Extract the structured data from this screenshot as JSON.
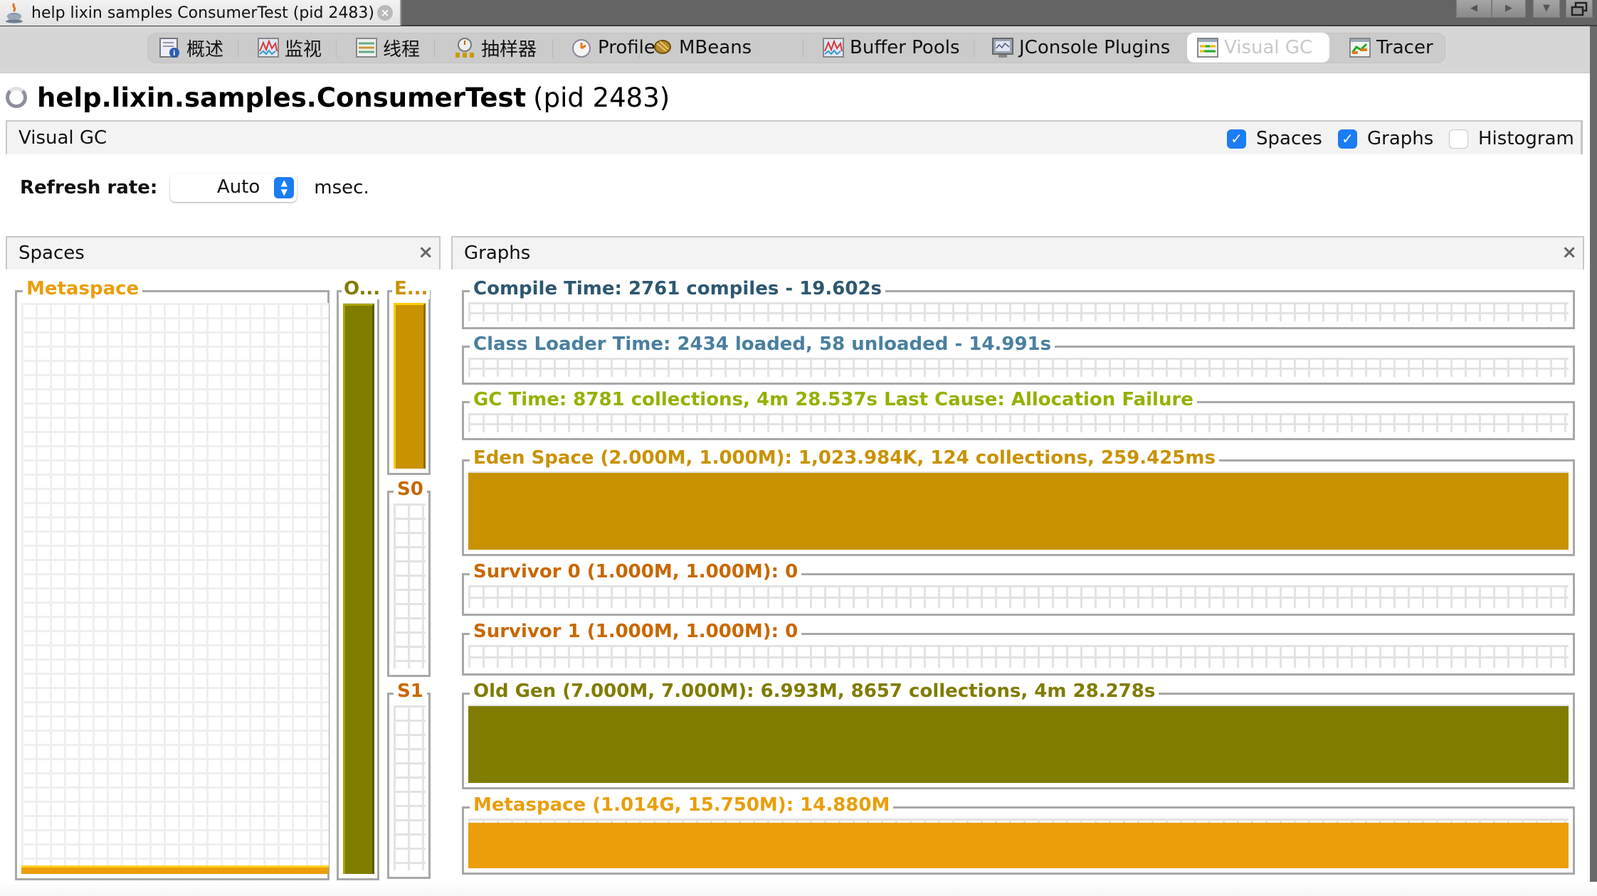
{
  "window": {
    "tab_label": "help lixin samples ConsumerTest (pid 2483)",
    "tab_icon": "java-cup-icon",
    "controls": [
      "scroll-left",
      "scroll-right",
      "tab-list",
      "restore-window"
    ]
  },
  "toolbar": {
    "items": [
      {
        "label": "概述",
        "icon": "overview-icon",
        "active": false
      },
      {
        "label": "监视",
        "icon": "monitor-icon",
        "active": false
      },
      {
        "label": "线程",
        "icon": "threads-icon",
        "active": false
      },
      {
        "label": "抽样器",
        "icon": "sampler-icon",
        "active": false
      },
      {
        "label": "Profiler",
        "icon": "profiler-icon",
        "active": false
      },
      {
        "label": "MBeans",
        "icon": "mbeans-icon",
        "active": false
      },
      {
        "label": "Buffer Pools",
        "icon": "buffer-pools-icon",
        "active": false
      },
      {
        "label": "JConsole Plugins",
        "icon": "jconsole-icon",
        "active": false
      },
      {
        "label": "Visual GC",
        "icon": "visual-gc-icon",
        "active": true
      },
      {
        "label": "Tracer",
        "icon": "tracer-icon",
        "active": false
      }
    ]
  },
  "header": {
    "app_name": "help.lixin.samples.ConsumerTest",
    "pid_text": "(pid 2483)"
  },
  "visual_gc": {
    "title": "Visual GC",
    "options": [
      {
        "label": "Spaces",
        "checked": true
      },
      {
        "label": "Graphs",
        "checked": true
      },
      {
        "label": "Histogram",
        "checked": false
      }
    ],
    "refresh_label": "Refresh rate:",
    "refresh_value": "Auto",
    "refresh_unit": "msec."
  },
  "spaces_panel": {
    "title": "Spaces",
    "close": "×",
    "metaspace": {
      "label": "Metaspace",
      "fill_fraction": 0.015,
      "color": "#eb9e0a"
    },
    "old": {
      "label": "O...",
      "fill_fraction": 0.999,
      "color": "#807c00"
    },
    "eden": {
      "label": "E...",
      "fill_fraction": 0.999,
      "color": "#c99200"
    },
    "s0": {
      "label": "S0",
      "fill_fraction": 0,
      "color": "#c86800"
    },
    "s1": {
      "label": "S1",
      "fill_fraction": 0,
      "color": "#c86800"
    }
  },
  "graphs_panel": {
    "title": "Graphs",
    "close": "×",
    "graphs": [
      {
        "label": "Compile Time: 2761 compiles - 19.602s",
        "color": "#2e5770",
        "fill_fraction": 0
      },
      {
        "label": "Class Loader Time: 2434 loaded, 58 unloaded - 14.991s",
        "color": "#4a7fa0",
        "fill_fraction": 0
      },
      {
        "label": "GC Time: 8781 collections, 4m 28.537s  Last Cause: Allocation Failure",
        "color": "#96b000",
        "fill_fraction": 0
      },
      {
        "label": "Eden Space (2.000M, 1.000M): 1,023.984K, 124 collections, 259.425ms",
        "color": "#c99200",
        "fill_fraction": 1.0
      },
      {
        "label": "Survivor 0 (1.000M, 1.000M): 0",
        "color": "#c86800",
        "fill_fraction": 0
      },
      {
        "label": "Survivor 1 (1.000M, 1.000M): 0",
        "color": "#c86800",
        "fill_fraction": 0
      },
      {
        "label": "Old Gen (7.000M, 7.000M): 6.993M, 8657 collections, 4m 28.278s",
        "color": "#807c00",
        "fill_fraction": 0.999
      },
      {
        "label": "Metaspace (1.014G, 15.750M): 14.880M",
        "color": "#eb9e0a",
        "fill_fraction": 0.945
      }
    ]
  }
}
